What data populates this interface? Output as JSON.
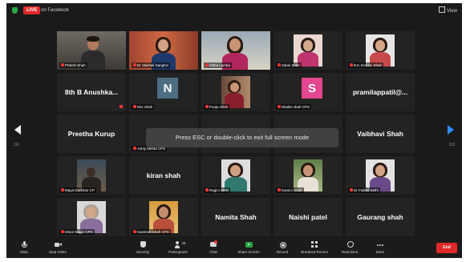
{
  "window": {
    "live_badge": "LIVE",
    "live_target": "on Facebook",
    "view_label": "View",
    "toast": "Press ESC or double-click to exit full screen mode",
    "pager_left": "1/2",
    "pager_right": "1/2"
  },
  "tiles": [
    {
      "caption": "Pritesh Shah"
    },
    {
      "caption": "Dr Vaishali Sanghvi"
    },
    {
      "caption": "Mitha Lamba"
    },
    {
      "caption": "Zalak Shah"
    },
    {
      "caption": "B.K.Sichani Shah"
    },
    {
      "name": "8th B Anushka..."
    },
    {
      "caption": "Mrs Shah",
      "initial": "N"
    },
    {
      "caption": "Pooja Shah"
    },
    {
      "caption": "Shalini shah CPS",
      "initial": "S"
    },
    {
      "name": "pramilappatil@..."
    },
    {
      "name": "Preetha Kurup"
    },
    {
      "caption": "Ashly Mehta CPS"
    },
    {},
    {},
    {
      "name": "Vaibhavi Shah"
    },
    {
      "caption": "Maya Darkhan CP"
    },
    {
      "name": "kiran shah"
    },
    {
      "caption": "Ragini Sethi"
    },
    {
      "caption": "Kamini Shah"
    },
    {
      "caption": "Dr Pallavi Sethi"
    },
    {
      "caption": "Minal Gajjar CPS"
    },
    {
      "caption": "Kamlesh Shah CPS"
    },
    {
      "name": "Namita Shah"
    },
    {
      "name": "Naishi patel"
    },
    {
      "name": "Gaurang shah"
    }
  ],
  "toolbar": {
    "mute": "Mute",
    "stop_video": "Stop Video",
    "security": "Security",
    "participants": "Participants",
    "participants_count": "28",
    "chat": "Chat",
    "share_screen": "Share Screen",
    "record": "Record",
    "breakout_rooms": "Breakout Rooms",
    "reactions": "Reactions",
    "more": "More",
    "end": "End"
  },
  "colors": {
    "speaking_border": "#b5c424",
    "live_red": "#e02828",
    "share_green": "#29a846",
    "nav_blue": "#2d8cff",
    "avatar_n": "#4d6e82",
    "avatar_s": "#e4468f"
  }
}
